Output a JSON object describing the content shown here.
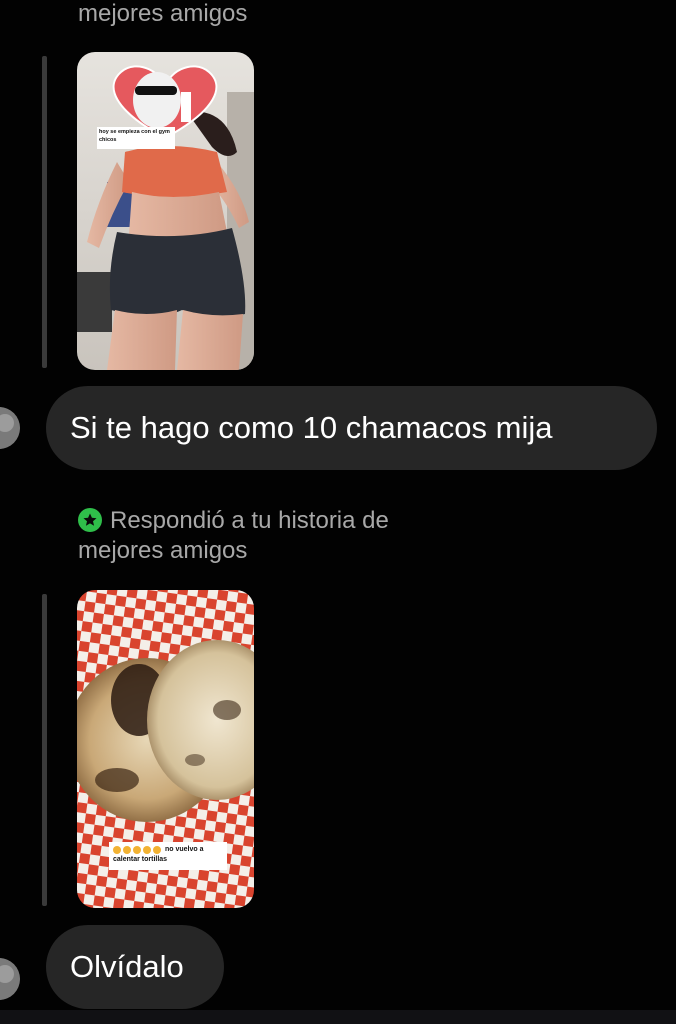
{
  "thread": {
    "first_caption_line2": "mejores amigos",
    "story1": {
      "overlay_text": "hoy se empieza con el gym chicos"
    },
    "message1": "Si te hago como 10 chamacos mija",
    "second_caption": {
      "line1": "Respondió a tu historia de",
      "line2": "mejores amigos"
    },
    "story2": {
      "overlay_text": "no vuelvo a calentar tortillas"
    },
    "message2": "Olvídalo"
  },
  "colors": {
    "background": "#020202",
    "bubble": "#262626",
    "caption": "#a8a8a8",
    "close_friends_badge": "#2fbf4a",
    "reply_line": "#3a3a3a"
  },
  "icons": {
    "close_friends": "green-star-badge-icon",
    "avatar": "user-avatar"
  }
}
